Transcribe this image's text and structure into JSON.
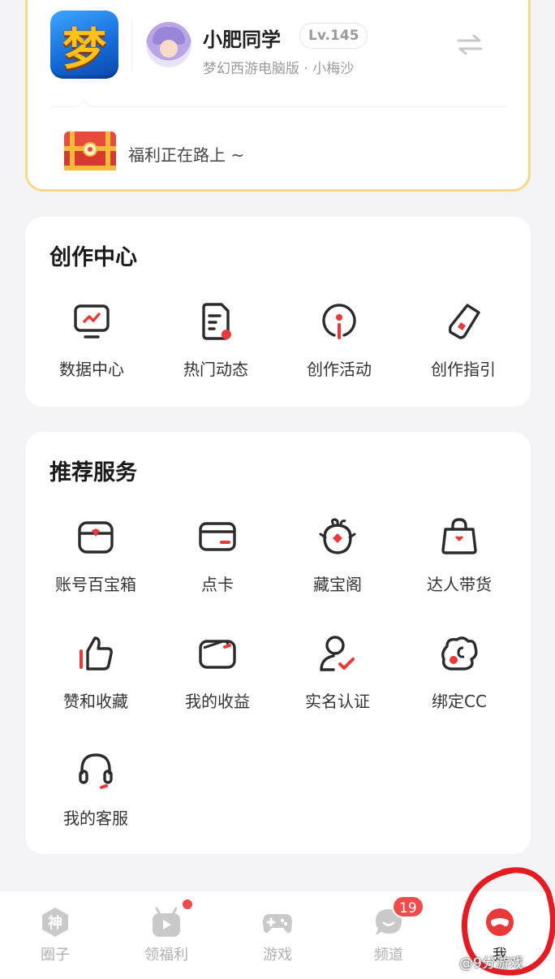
{
  "game_card": {
    "logo_char": "梦",
    "user_name": "小肥同学",
    "level": "Lv.145",
    "server": "梦幻西游电脑版 · 小梅沙",
    "welfare_text": "福利正在路上 ~"
  },
  "creation_center": {
    "title": "创作中心",
    "items": [
      {
        "label": "数据中心",
        "icon": "monitor-chart-icon"
      },
      {
        "label": "热门动态",
        "icon": "document-icon"
      },
      {
        "label": "创作活动",
        "icon": "activity-icon"
      },
      {
        "label": "创作指引",
        "icon": "pen-icon"
      }
    ]
  },
  "recommended_services": {
    "title": "推荐服务",
    "items": [
      {
        "label": "账号百宝箱",
        "icon": "treasure-box-icon"
      },
      {
        "label": "点卡",
        "icon": "card-icon"
      },
      {
        "label": "藏宝阁",
        "icon": "treasure-pavilion-icon"
      },
      {
        "label": "达人带货",
        "icon": "shopping-bag-icon"
      },
      {
        "label": "赞和收藏",
        "icon": "thumbs-up-icon"
      },
      {
        "label": "我的收益",
        "icon": "wallet-icon"
      },
      {
        "label": "实名认证",
        "icon": "user-verified-icon"
      },
      {
        "label": "绑定CC",
        "icon": "cc-bind-icon"
      },
      {
        "label": "我的客服",
        "icon": "headset-icon"
      }
    ]
  },
  "tabbar": {
    "tabs": [
      {
        "label": "圈子",
        "icon": "shen-hexagon-icon"
      },
      {
        "label": "领福利",
        "icon": "gift-play-icon"
      },
      {
        "label": "游戏",
        "icon": "gamepad-icon"
      },
      {
        "label": "频道",
        "icon": "chat-bubble-icon",
        "badge": "19"
      },
      {
        "label": "我",
        "icon": "profile-mask-icon",
        "active": true
      }
    ]
  },
  "watermark": "@9分游戏",
  "colors": {
    "accent_red": "#e8393b",
    "card_border": "#f7d98a",
    "icon_dark": "#2b2b2b",
    "annotation_red": "#e51b23"
  }
}
